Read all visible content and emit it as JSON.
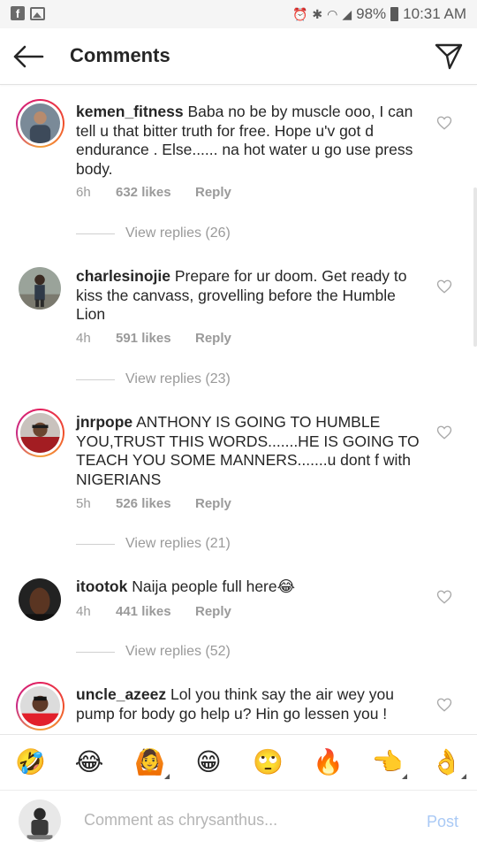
{
  "status_bar": {
    "battery": "98%",
    "time": "10:31 AM",
    "icons": [
      "facebook-icon",
      "gallery-icon",
      "alarm-icon",
      "bluetooth-icon",
      "wifi-icon",
      "signal-icon",
      "battery-icon"
    ]
  },
  "header": {
    "title": "Comments",
    "back_icon": "arrow-left-icon",
    "share_icon": "paper-plane-icon"
  },
  "comments": [
    {
      "username": "kemen_fitness",
      "text": "Baba no be by muscle ooo, I can tell u that bitter truth for free. Hope u'v got d endurance . Else...... na hot water u go use press body.",
      "age": "6h",
      "likes": "632 likes",
      "reply": "Reply",
      "view_replies": "View replies (26)"
    },
    {
      "username": "charlesinojie",
      "text": "Prepare for ur doom. Get ready to kiss the canvass, grovelling before the Humble Lion",
      "age": "4h",
      "likes": "591 likes",
      "reply": "Reply",
      "view_replies": "View replies (23)"
    },
    {
      "username": "jnrpope",
      "text": "ANTHONY IS GOING TO HUMBLE YOU,TRUST THIS WORDS.......HE IS GOING TO TEACH YOU SOME MANNERS.......u dont f with NIGERIANS",
      "age": "5h",
      "likes": "526 likes",
      "reply": "Reply",
      "view_replies": "View replies (21)"
    },
    {
      "username": "itootok",
      "text": "Naija people full here😂",
      "age": "4h",
      "likes": "441 likes",
      "reply": "Reply",
      "view_replies": "View replies (52)"
    },
    {
      "username": "uncle_azeez",
      "text": "Lol you think say the air wey you pump for body go help u? Hin go lessen you !"
    }
  ],
  "emoji_bar": [
    "🤣",
    "😂",
    "🙆",
    "😁",
    "🙄",
    "🔥",
    "👈",
    "👌"
  ],
  "compose": {
    "placeholder": "Comment as chrysanthus...",
    "post_label": "Post"
  },
  "colors": {
    "text": "#262626",
    "meta": "#9a9a9a",
    "post_disabled": "#a9c9f5",
    "story_ring": "#e3205f"
  }
}
